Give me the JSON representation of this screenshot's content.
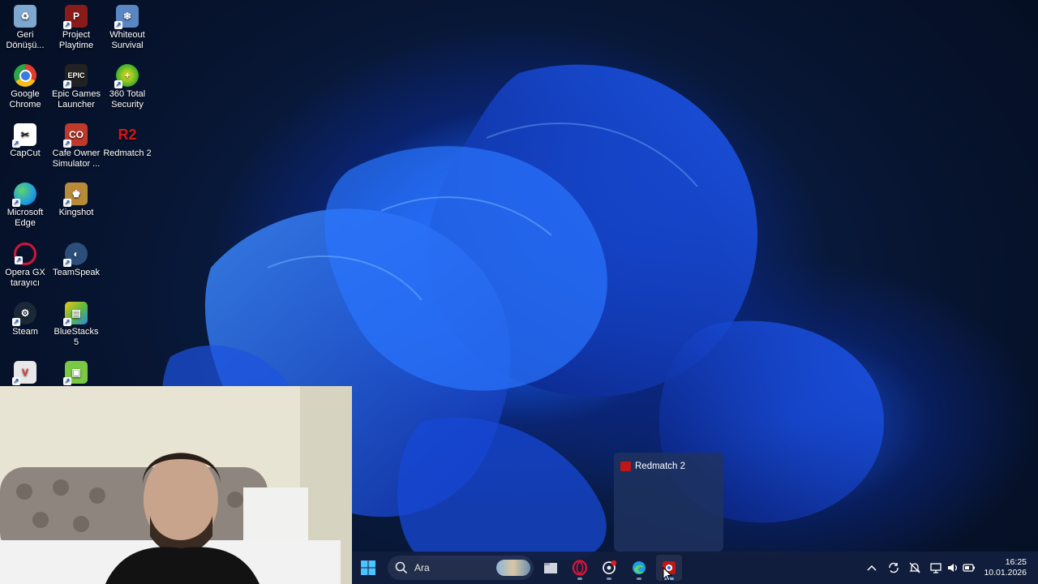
{
  "desktop": {
    "icons": [
      {
        "label": "Geri Dönüşü...",
        "icon": "recycle-bin-icon",
        "color": "#7fa8d0"
      },
      {
        "label": "Project Playtime",
        "icon": "project-playtime-icon",
        "color": "#8a1b1b"
      },
      {
        "label": "Whiteout Survival",
        "icon": "whiteout-survival-icon",
        "color": "#5b86c4"
      },
      {
        "label": "Google Chrome",
        "icon": "chrome-icon",
        "color": "#e33b2e"
      },
      {
        "label": "Epic Games Launcher",
        "icon": "epic-games-icon",
        "color": "#222222"
      },
      {
        "label": "360 Total Security",
        "icon": "360-security-icon",
        "color": "#3cae2a"
      },
      {
        "label": "CapCut",
        "icon": "capcut-icon",
        "color": "#ffffff"
      },
      {
        "label": "Cafe Owner Simulator ...",
        "icon": "cafe-owner-icon",
        "color": "#c0392b"
      },
      {
        "label": "Redmatch 2",
        "icon": "redmatch-icon",
        "color": "#c01616"
      },
      {
        "label": "Microsoft Edge",
        "icon": "edge-icon",
        "color": "#1f9de0"
      },
      {
        "label": "Kingshot",
        "icon": "kingshot-icon",
        "color": "#b88b3a"
      },
      {
        "label": "Opera GX tarayıcı",
        "icon": "opera-gx-icon",
        "color": "#d0163a"
      },
      {
        "label": "TeamSpeak",
        "icon": "teamspeak-icon",
        "color": "#2b4f7a"
      },
      {
        "label": "Steam",
        "icon": "steam-icon",
        "color": "#1b2838"
      },
      {
        "label": "BlueStacks 5",
        "icon": "bluestacks-icon",
        "color": "#5fbb3a"
      },
      {
        "label": "",
        "icon": "valorant-icon",
        "color": "#e8e8e8"
      },
      {
        "label": "",
        "icon": "android-app-icon",
        "color": "#7ac943"
      }
    ]
  },
  "preview": {
    "title": "Redmatch 2"
  },
  "taskbar": {
    "search_placeholder": "Ara",
    "apps": [
      {
        "name": "file-explorer-icon"
      },
      {
        "name": "opera-gx-icon"
      },
      {
        "name": "chatgpt-icon"
      },
      {
        "name": "edge-icon"
      },
      {
        "name": "redmatch-icon"
      }
    ],
    "time": "16:25",
    "date": "10.01.2026"
  }
}
